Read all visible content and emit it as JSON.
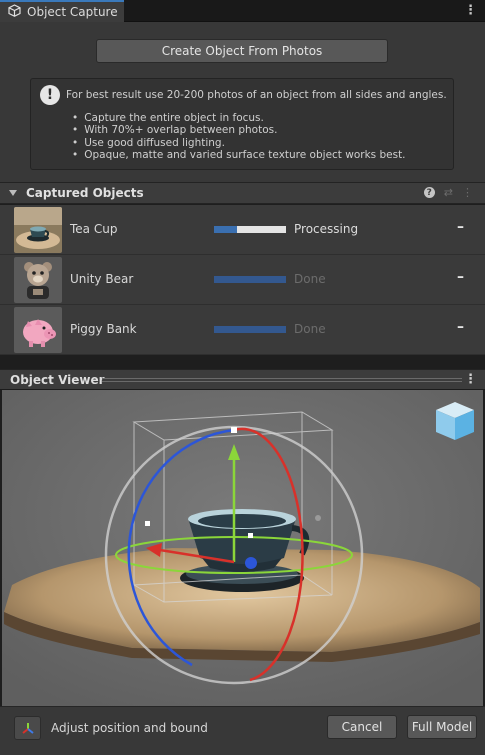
{
  "window": {
    "tab_title": "Object Capture",
    "menu_glyph": "⋮"
  },
  "capture_panel": {
    "create_button": "Create Object From Photos",
    "info": {
      "title": "For best result use 20-200 photos of an object from all sides and angles.",
      "tips": [
        "Capture the entire object in focus.",
        "With 70%+ overlap between photos.",
        "Use good diffused lighting.",
        "Opaque, matte and varied surface texture object works best."
      ]
    }
  },
  "captured_objects": {
    "title": "Captured Objects",
    "items": [
      {
        "name": "Tea Cup",
        "status": "Processing",
        "progress": 0.32,
        "state": "processing",
        "thumb": "tea-cup-thumbnail"
      },
      {
        "name": "Unity Bear",
        "status": "Done",
        "progress": 1.0,
        "state": "done",
        "thumb": "unity-bear-thumbnail"
      },
      {
        "name": "Piggy Bank",
        "status": "Done",
        "progress": 1.0,
        "state": "done",
        "thumb": "piggy-bank-thumbnail"
      }
    ],
    "remove_glyph": "–"
  },
  "viewer": {
    "title": "Object Viewer"
  },
  "footer": {
    "adjust_label": "Adjust position and bound",
    "cancel_button": "Cancel",
    "full_model_button": "Full Model"
  },
  "colors": {
    "accent": "#3a79bb",
    "progress_fill": "#3a6fb0",
    "x_axis": "#d8312a",
    "y_axis": "#8bd63a",
    "z_axis": "#2c56d8"
  }
}
